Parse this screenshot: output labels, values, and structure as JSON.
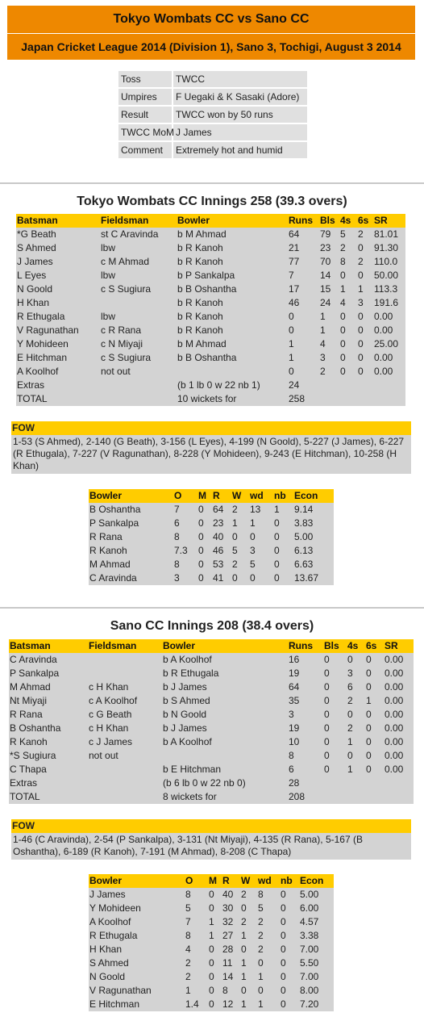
{
  "header": {
    "title": "Tokyo Wombats CC vs Sano CC",
    "subtitle": "Japan Cricket League 2014 (Division 1), Sano 3, Tochigi, August 3 2014"
  },
  "info": [
    {
      "label": "Toss",
      "value": "TWCC"
    },
    {
      "label": "Umpires",
      "value": "F Uegaki & K Sasaki (Adore)"
    },
    {
      "label": "Result",
      "value": "TWCC won by 50 runs"
    },
    {
      "label": "TWCC MoM",
      "value": "J James"
    },
    {
      "label": "Comment",
      "value": "Extremely hot and humid"
    }
  ],
  "colors": {
    "header": "#ee8800",
    "table_header": "#ffcc00",
    "row": "#d3d3d3"
  },
  "innings": [
    {
      "title": "Tokyo Wombats CC Innings 258 (39.3 overs)",
      "batting_headers": [
        "Batsman",
        "Fieldsman",
        "Bowler",
        "Runs",
        "Bls",
        "4s",
        "6s",
        "SR"
      ],
      "batting": [
        [
          "*G Beath",
          "st C Aravinda",
          "b M Ahmad",
          "64",
          "79",
          "5",
          "2",
          "81.01"
        ],
        [
          "S Ahmed",
          "lbw",
          "b R Kanoh",
          "21",
          "23",
          "2",
          "0",
          "91.30"
        ],
        [
          "J James",
          "c M Ahmad",
          "b R Kanoh",
          "77",
          "70",
          "8",
          "2",
          "110.0"
        ],
        [
          "L Eyes",
          "lbw",
          "b P Sankalpa",
          "7",
          "14",
          "0",
          "0",
          "50.00"
        ],
        [
          "N Goold",
          "c S Sugiura",
          "b B Oshantha",
          "17",
          "15",
          "1",
          "1",
          "113.3"
        ],
        [
          "H Khan",
          "",
          "b R Kanoh",
          "46",
          "24",
          "4",
          "3",
          "191.6"
        ],
        [
          "R Ethugala",
          "lbw",
          "b R Kanoh",
          "0",
          "1",
          "0",
          "0",
          "0.00"
        ],
        [
          "V Ragunathan",
          "c R Rana",
          "b R Kanoh",
          "0",
          "1",
          "0",
          "0",
          "0.00"
        ],
        [
          "Y Mohideen",
          "c N Miyaji",
          "b M Ahmad",
          "1",
          "4",
          "0",
          "0",
          "25.00"
        ],
        [
          "E Hitchman",
          "c S Sugiura",
          "b B Oshantha",
          "1",
          "3",
          "0",
          "0",
          "0.00"
        ],
        [
          "A Koolhof",
          "not out",
          "",
          "0",
          "2",
          "0",
          "0",
          "0.00"
        ],
        [
          "Extras",
          "",
          "(b 1 lb 0 w 22 nb 1)",
          "24",
          "",
          "",
          "",
          ""
        ],
        [
          "TOTAL",
          "",
          "10 wickets for",
          "258",
          "",
          "",
          "",
          ""
        ]
      ],
      "fow_label": "FOW",
      "fow": "1-53 (S Ahmed), 2-140 (G Beath), 3-156 (L Eyes), 4-199 (N Goold), 5-227 (J James), 6-227 (R Ethugala), 7-227 (V Ragunathan), 8-228 (Y Mohideen), 9-243 (E Hitchman), 10-258 (H Khan)",
      "bowling_headers": [
        "Bowler",
        "O",
        "M",
        "R",
        "W",
        "wd",
        "nb",
        "Econ"
      ],
      "bowling": [
        [
          "B Oshantha",
          "7",
          "0",
          "64",
          "2",
          "13",
          "1",
          "9.14"
        ],
        [
          "P Sankalpa",
          "6",
          "0",
          "23",
          "1",
          "1",
          "0",
          "3.83"
        ],
        [
          "R Rana",
          "8",
          "0",
          "40",
          "0",
          "0",
          "0",
          "5.00"
        ],
        [
          "R Kanoh",
          "7.3",
          "0",
          "46",
          "5",
          "3",
          "0",
          "6.13"
        ],
        [
          "M Ahmad",
          "8",
          "0",
          "53",
          "2",
          "5",
          "0",
          "6.63"
        ],
        [
          "C Aravinda",
          "3",
          "0",
          "41",
          "0",
          "0",
          "0",
          "13.67"
        ]
      ]
    },
    {
      "title": "Sano CC Innings 208 (38.4 overs)",
      "batting_headers": [
        "Batsman",
        "Fieldsman",
        "Bowler",
        "Runs",
        "Bls",
        "4s",
        "6s",
        "SR"
      ],
      "batting": [
        [
          "C Aravinda",
          "",
          "b A Koolhof",
          "16",
          "0",
          "0",
          "0",
          "0.00"
        ],
        [
          "P Sankalpa",
          "",
          "b R Ethugala",
          "19",
          "0",
          "3",
          "0",
          "0.00"
        ],
        [
          "M Ahmad",
          "c H Khan",
          "b J James",
          "64",
          "0",
          "6",
          "0",
          "0.00"
        ],
        [
          "Nt Miyaji",
          "c A Koolhof",
          "b S Ahmed",
          "35",
          "0",
          "2",
          "1",
          "0.00"
        ],
        [
          "R Rana",
          "c G Beath",
          "b N Goold",
          "3",
          "0",
          "0",
          "0",
          "0.00"
        ],
        [
          "B Oshantha",
          "c H Khan",
          "b J James",
          "19",
          "0",
          "2",
          "0",
          "0.00"
        ],
        [
          "R Kanoh",
          "c J James",
          "b A Koolhof",
          "10",
          "0",
          "1",
          "0",
          "0.00"
        ],
        [
          "*S Sugiura",
          "not out",
          "",
          "8",
          "0",
          "0",
          "0",
          "0.00"
        ],
        [
          "C Thapa",
          "",
          "b E Hitchman",
          "6",
          "0",
          "1",
          "0",
          "0.00"
        ],
        [
          "Extras",
          "",
          "(b 6 lb 0 w 22 nb 0)",
          "28",
          "",
          "",
          "",
          ""
        ],
        [
          "TOTAL",
          "",
          "8 wickets for",
          "208",
          "",
          "",
          "",
          ""
        ]
      ],
      "fow_label": "FOW",
      "fow": "1-46 (C Aravinda), 2-54 (P Sankalpa), 3-131 (Nt Miyaji), 4-135 (R Rana), 5-167 (B Oshantha), 6-189 (R Kanoh), 7-191 (M Ahmad), 8-208 (C Thapa)",
      "bowling_headers": [
        "Bowler",
        "O",
        "M",
        "R",
        "W",
        "wd",
        "nb",
        "Econ"
      ],
      "bowling": [
        [
          "J James",
          "8",
          "0",
          "40",
          "2",
          "8",
          "0",
          "5.00"
        ],
        [
          "Y Mohideen",
          "5",
          "0",
          "30",
          "0",
          "5",
          "0",
          "6.00"
        ],
        [
          "A Koolhof",
          "7",
          "1",
          "32",
          "2",
          "2",
          "0",
          "4.57"
        ],
        [
          "R Ethugala",
          "8",
          "1",
          "27",
          "1",
          "2",
          "0",
          "3.38"
        ],
        [
          "H Khan",
          "4",
          "0",
          "28",
          "0",
          "2",
          "0",
          "7.00"
        ],
        [
          "S Ahmed",
          "2",
          "0",
          "11",
          "1",
          "0",
          "0",
          "5.50"
        ],
        [
          "N Goold",
          "2",
          "0",
          "14",
          "1",
          "1",
          "0",
          "7.00"
        ],
        [
          "V Ragunathan",
          "1",
          "0",
          "8",
          "0",
          "0",
          "0",
          "8.00"
        ],
        [
          "E Hitchman",
          "1.4",
          "0",
          "12",
          "1",
          "1",
          "0",
          "7.20"
        ]
      ]
    }
  ]
}
